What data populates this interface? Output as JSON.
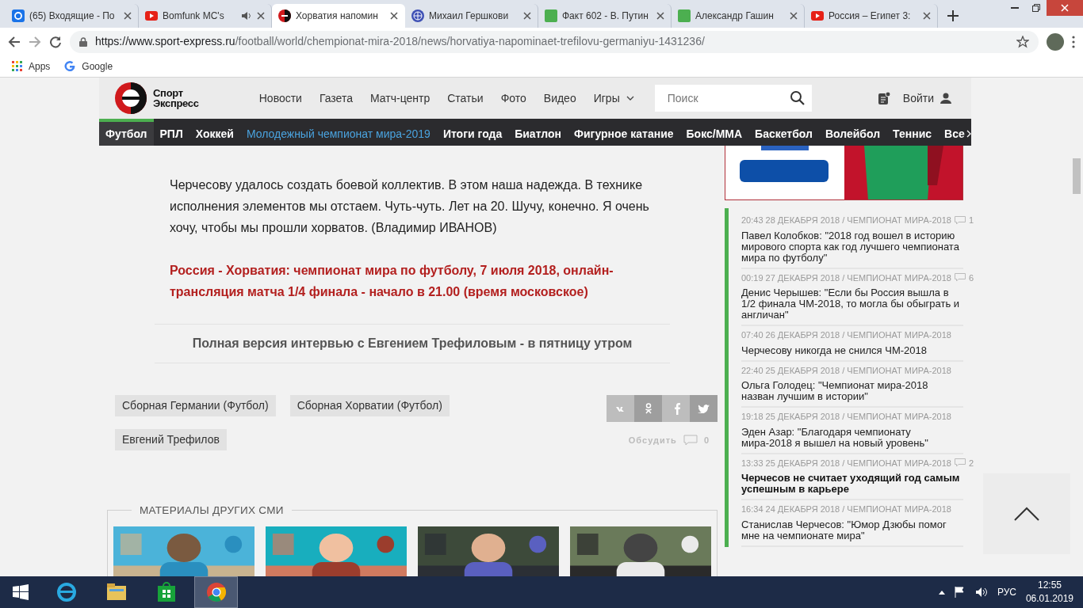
{
  "browser": {
    "tabs": [
      {
        "title": "(65) Входящие - По",
        "kind": "mail",
        "selected": false,
        "audio": false
      },
      {
        "title": "Bomfunk MC's",
        "kind": "youtube",
        "selected": false,
        "audio": true
      },
      {
        "title": "Хорватия напомин",
        "kind": "site",
        "selected": true,
        "audio": false
      },
      {
        "title": "Михаил Гершкови",
        "kind": "globe",
        "selected": false,
        "audio": false
      },
      {
        "title": "Факт 602 - В. Путин",
        "kind": "sheet",
        "selected": false,
        "audio": false
      },
      {
        "title": "Александр Гашин",
        "kind": "sheet",
        "selected": false,
        "audio": false
      },
      {
        "title": "Россия – Египет 3:",
        "kind": "youtube",
        "selected": false,
        "audio": false
      }
    ],
    "address": {
      "host": "https://www.sport-express.ru",
      "path": "/football/world/chempionat-mira-2018/news/horvatiya-napominaet-trefilovu-germaniyu-1431236/"
    },
    "bookmarks": [
      {
        "label": "Apps",
        "kind": "apps"
      },
      {
        "label": "Google",
        "kind": "google"
      }
    ]
  },
  "site": {
    "logo_lines": [
      "Спорт",
      "Экспресс"
    ],
    "nav": [
      {
        "label": "Новости",
        "dropdown": false
      },
      {
        "label": "Газета",
        "dropdown": false
      },
      {
        "label": "Матч-центр",
        "dropdown": false
      },
      {
        "label": "Статьи",
        "dropdown": false
      },
      {
        "label": "Фото",
        "dropdown": false
      },
      {
        "label": "Видео",
        "dropdown": false
      },
      {
        "label": "Игры",
        "dropdown": true
      }
    ],
    "search": {
      "placeholder": "Поиск"
    },
    "login": "Войти",
    "sports": [
      {
        "label": "Футбол",
        "selected": true,
        "kind": "plain"
      },
      {
        "label": "РПЛ",
        "selected": false,
        "kind": "plain"
      },
      {
        "label": "Хоккей",
        "selected": false,
        "kind": "plain"
      },
      {
        "label": "Молодежный чемпионат мира-2019",
        "selected": false,
        "kind": "promo"
      },
      {
        "label": "Итоги года",
        "selected": false,
        "kind": "plain"
      },
      {
        "label": "Биатлон",
        "selected": false,
        "kind": "plain"
      },
      {
        "label": "Фигурное катание",
        "selected": false,
        "kind": "plain"
      },
      {
        "label": "Бокс/ММА",
        "selected": false,
        "kind": "plain"
      },
      {
        "label": "Баскетбол",
        "selected": false,
        "kind": "plain"
      },
      {
        "label": "Волейбол",
        "selected": false,
        "kind": "plain"
      },
      {
        "label": "Теннис",
        "selected": false,
        "kind": "plain"
      },
      {
        "label": "Все",
        "selected": false,
        "kind": "more"
      }
    ]
  },
  "article": {
    "paragraphs": [
      {
        "kind": "text",
        "text": "Черчесову удалось создать боевой коллектив. В этом наша надежда. В технике исполнения элементов мы отстаем. Чуть-чуть. Лет на 20. Шучу, конечно. Я очень хочу, чтобы мы прошли хорватов. (Владимир ИВАНОВ)"
      },
      {
        "kind": "link",
        "text": "Россия - Хорватия: чемпионат мира по футболу, 7 июля 2018, онлайн-трансляция матча 1/4 финала - начало в 21.00 (время московское)"
      }
    ],
    "teaser": "Полная версия интервью с Евгением Трефиловым - в пятницу утром",
    "tags": [
      "Сборная Германии (Футбол)",
      "Сборная Хорватии (Футбол)",
      "Евгений Трефилов"
    ],
    "share": [
      {
        "kind": "vk"
      },
      {
        "kind": "ok"
      },
      {
        "kind": "fb"
      },
      {
        "kind": "tw"
      }
    ],
    "discuss": {
      "label": "Обсудить",
      "count": "0"
    },
    "other_media": {
      "title": "МАТЕРИАЛЫ ДРУГИХ СМИ"
    }
  },
  "sidebar": {
    "news": [
      {
        "meta": "20:43 28 ДЕКАБРЯ 2018 / ЧЕМПИОНАТ МИРА-2018",
        "comments": "1",
        "title": "Павел Колобков: \"2018 год вошел в историю мирового спорта как год лучшего чемпионата мира по футболу\"",
        "bold": false
      },
      {
        "meta": "00:19 27 ДЕКАБРЯ 2018 / ЧЕМПИОНАТ МИРА-2018",
        "comments": "6",
        "title": "Денис Черышев: \"Если бы Россия вышла в 1/2 финала ЧМ-2018, то могла бы обыграть и англичан\"",
        "bold": false
      },
      {
        "meta": "07:40 26 ДЕКАБРЯ 2018 / ЧЕМПИОНАТ МИРА-2018",
        "title": "Черчесову никогда не снился ЧМ-2018",
        "bold": false
      },
      {
        "meta": "22:40 25 ДЕКАБРЯ 2018 / ЧЕМПИОНАТ МИРА-2018",
        "title": "Ольга Голодец: \"Чемпионат мира-2018 назван лучшим в истории\"",
        "bold": false
      },
      {
        "meta": "19:18 25 ДЕКАБРЯ 2018 / ЧЕМПИОНАТ МИРА-2018",
        "title": "Эден Азар: \"Благодаря чемпионату мира-2018 я вышел на новый уровень\"",
        "bold": false
      },
      {
        "meta": "13:33 25 ДЕКАБРЯ 2018 / ЧЕМПИОНАТ МИРА-2018",
        "comments": "2",
        "title": "Черчесов не считает уходящий год самым успешным в карьере",
        "bold": true
      },
      {
        "meta": "16:34 24 ДЕКАБРЯ 2018 / ЧЕМПИОНАТ МИРА-2018",
        "title": "Станислав Черчесов: \"Юмор Дзюбы помог мне на чемпионате мира\"",
        "bold": false
      }
    ]
  },
  "taskbar": {
    "apps": [
      {
        "kind": "ie",
        "selected": false
      },
      {
        "kind": "explorer",
        "selected": false
      },
      {
        "kind": "store",
        "selected": false
      },
      {
        "kind": "chrome",
        "selected": true
      }
    ],
    "language": "РУС",
    "time": "12:55",
    "date": "06.01.2019"
  }
}
